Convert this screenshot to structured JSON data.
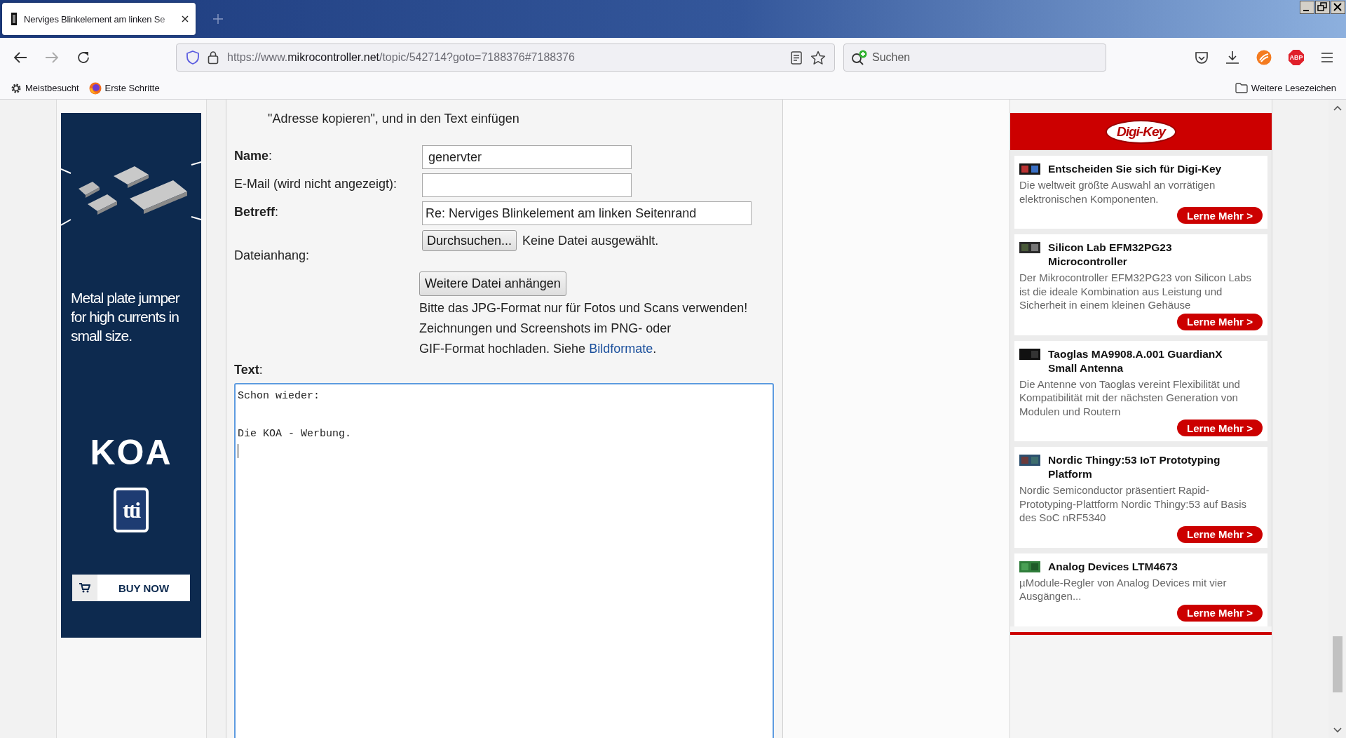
{
  "browser": {
    "tab": {
      "title": "Nerviges Blinkelement am linken Se",
      "selected": true
    },
    "address": {
      "scheme": "https://www.",
      "domain": "mikrocontroller.net",
      "path": "/topic/542714?goto=7188376#7188376"
    },
    "search": {
      "placeholder": "Suchen"
    },
    "adblock_label": "ABP",
    "bookmarks": [
      {
        "label": "Meistbesucht",
        "kind": "gear"
      },
      {
        "label": "Erste Schritte",
        "kind": "firefox"
      }
    ],
    "other_bookmarks": "Weitere Lesezeichen"
  },
  "left_ad": {
    "headline": "Metal plate jumper for high currents in small size.",
    "brand": "KOA",
    "partner": "tti",
    "button": "BUY NOW"
  },
  "form": {
    "intro_lines": [
      "\"Adresse kopieren\", und in den Text einfügen"
    ],
    "fields": [
      {
        "kind": "text",
        "label": "**Name**:",
        "value": "genervter"
      },
      {
        "kind": "text",
        "label": "E-Mail (wird nicht angezeigt):"
      },
      {
        "kind": "wide_text",
        "label": "**Betreff**:",
        "value": "Re: Nerviges Blinkelement am linken Seitenrand"
      },
      {
        "kind": "file",
        "label": "Dateianhang:",
        "button": "Durchsuchen...",
        "status": "Keine Datei ausgewählt."
      }
    ],
    "add_file_button": "Weitere Datei anhängen",
    "hint": {
      "lines": [
        "Bitte das JPG-Format nur für Fotos und Scans verwenden!",
        "Zeichnungen und Screenshots im PNG- oder",
        "GIF-Format hochladen. Siehe "
      ],
      "link": "Bildformate",
      "end": "."
    },
    "text": {
      "label": "**Text**:",
      "value": "Schon wieder:\n\nDie KOA - Werbung.\n"
    }
  },
  "right_ad": {
    "logo": "Digi-Key",
    "items": [
      {
        "title": "Entscheiden Sie sich für Digi-Key",
        "description": "Die weltweit größte Auswahl an vorrätigen elektronischen Komponenten.",
        "button": "Lerne Mehr >"
      },
      {
        "title": "Silicon Lab EFM32PG23 Microcontroller",
        "description": "Der Mikrocontroller EFM32PG23 von Silicon Labs ist die ideale Kombination aus Leistung und Sicherheit in einem kleinen Gehäuse",
        "button": "Lerne Mehr >"
      },
      {
        "title": "Taoglas MA9908.A.001 GuardianX Small Antenna",
        "description": "Die Antenne von Taoglas vereint Flexibilität und Kompatibilität mit der nächsten Generation von Modulen und Routern",
        "button": "Lerne Mehr >"
      },
      {
        "title": "Nordic Thingy:53 IoT Prototyping Platform",
        "description": "Nordic Semiconductor präsentiert Rapid-Prototyping-Plattform Nordic Thingy:53 auf Basis des SoC nRF5340",
        "button": "Lerne Mehr >"
      },
      {
        "title": "Analog Devices LTM4673",
        "description": "µModule-Regler von Analog Devices mit vier Ausgängen...",
        "button": "Lerne Mehr >"
      }
    ]
  }
}
